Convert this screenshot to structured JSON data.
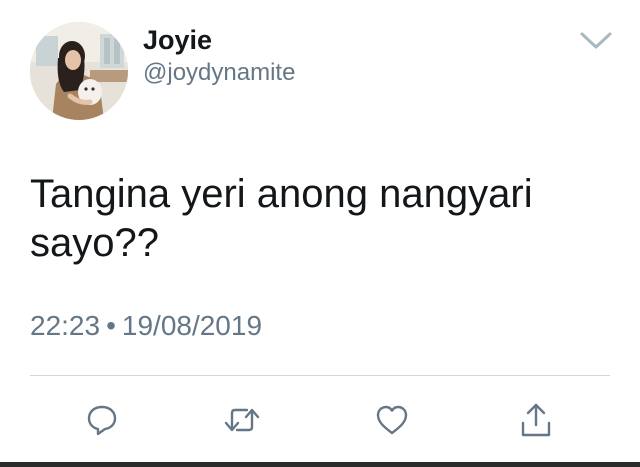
{
  "user": {
    "display_name": "Joyie",
    "handle": "@joydynamite"
  },
  "tweet": {
    "text": "Tangina yeri anong nangyari sayo??",
    "time": "22:23",
    "separator": "•",
    "date": "19/08/2019"
  },
  "icons": {
    "menu": "chevron-down-icon",
    "reply": "reply-icon",
    "retweet": "retweet-icon",
    "like": "heart-icon",
    "share": "share-icon"
  },
  "colors": {
    "text": "#14171a",
    "secondary": "#657786",
    "divider": "#d4d8dc"
  }
}
